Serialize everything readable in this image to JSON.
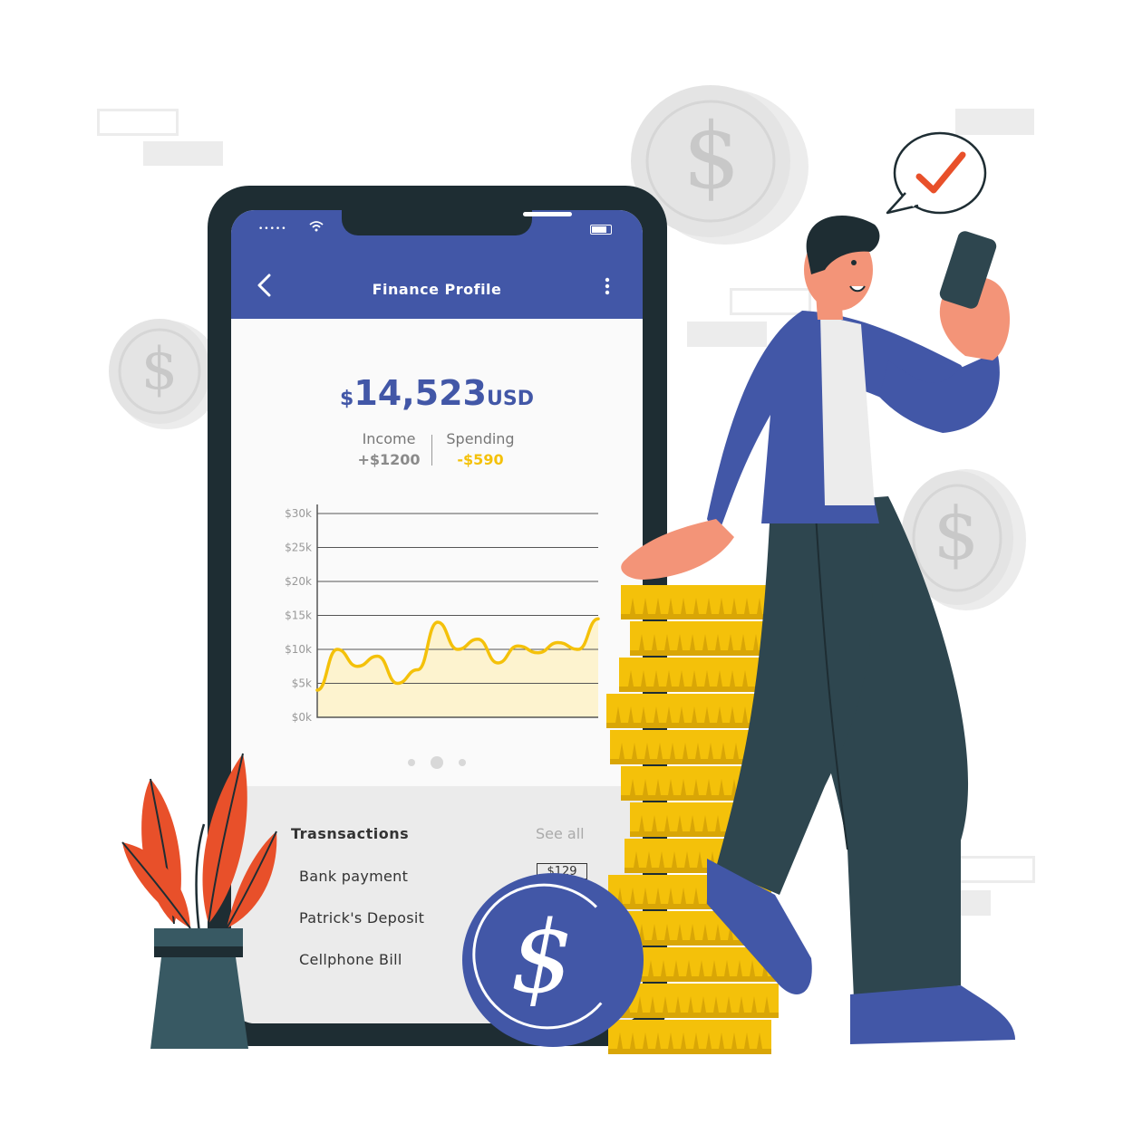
{
  "app": {
    "title": "Finance Profile",
    "back_icon": "back-arrow-icon",
    "menu_icon": "more-vertical-icon"
  },
  "status_bar": {
    "signal": "•••••",
    "wifi": "wifi-icon",
    "battery": "battery-icon"
  },
  "balance": {
    "currency_symbol": "$",
    "amount": "14,523",
    "unit": "USD"
  },
  "summary": {
    "income_label": "Income",
    "income_value": "+$1200",
    "spending_label": "Spending",
    "spending_value": "-$590"
  },
  "chart_data": {
    "type": "area",
    "y_ticks": [
      "$30k",
      "$25k",
      "$20k",
      "$15k",
      "$10k",
      "$5k",
      "$0k"
    ],
    "ylim": [
      0,
      30000
    ],
    "grid": true,
    "x": [
      0,
      1,
      2,
      3,
      4,
      5,
      6,
      7,
      8,
      9,
      10,
      11,
      12,
      13,
      14,
      15,
      16
    ],
    "values": [
      4000,
      10000,
      7500,
      9000,
      5000,
      7000,
      14000,
      10000,
      11500,
      8000,
      10500,
      9500,
      11000,
      10000,
      14500
    ],
    "colors": {
      "line": "#f4c10a",
      "fill": "#fdf3cf"
    }
  },
  "pager": {
    "count": 3,
    "active": 1
  },
  "transactions": {
    "title": "Trasnsactions",
    "see_all": "See all",
    "items": [
      {
        "name": "Bank payment",
        "amount": "$129"
      },
      {
        "name": "Patrick's Deposit"
      },
      {
        "name": "Cellphone Bill"
      }
    ]
  },
  "decor": {
    "coin_symbol": "$",
    "check_icon": "check-icon"
  },
  "colors": {
    "primary": "#4257a7",
    "accent": "#f4c10a",
    "dark": "#1e2d33",
    "plant": "#e8502a"
  }
}
